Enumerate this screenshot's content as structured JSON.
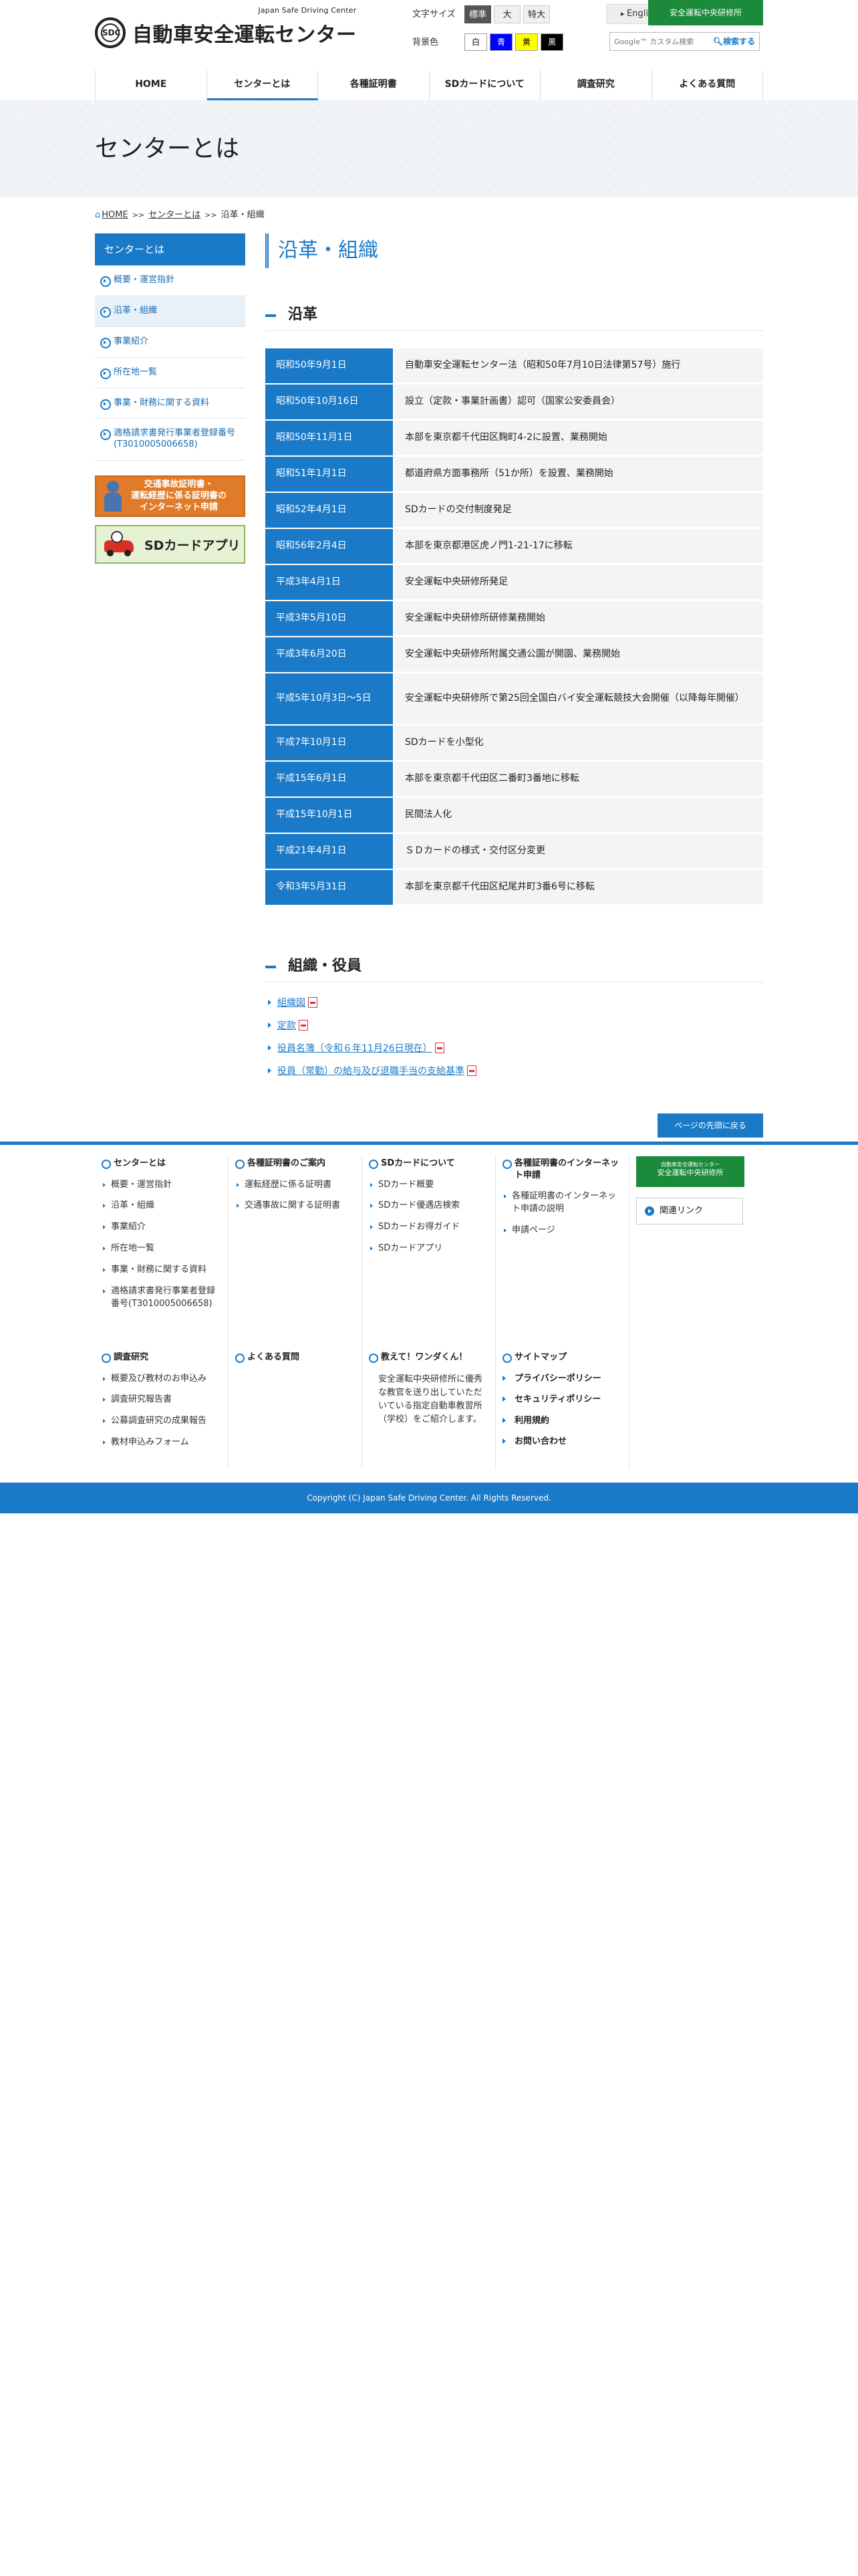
{
  "header": {
    "logo_sub": "Japan Safe Driving Center",
    "logo_main": "自動車安全運転センター",
    "logo_mark": "SDC",
    "font_size_label": "文字サイズ",
    "font_sizes": [
      "標準",
      "大",
      "特大"
    ],
    "english": "English",
    "training_center": "安全運転中央研修所",
    "bg_label": "背景色",
    "bg_colors": [
      {
        "label": "白",
        "bg": "#ffffff",
        "fg": "#000000"
      },
      {
        "label": "青",
        "bg": "#0000ff",
        "fg": "#ffffff"
      },
      {
        "label": "黄",
        "bg": "#ffff00",
        "fg": "#000000"
      },
      {
        "label": "黒",
        "bg": "#000000",
        "fg": "#ffffff"
      }
    ],
    "search_placeholder": "Google™ カスタム検索",
    "search_button": "検索する"
  },
  "gnav": [
    "HOME",
    "センターとは",
    "各種証明書",
    "SDカードについて",
    "調査研究",
    "よくある質問"
  ],
  "page_title": "センターとは",
  "breadcrumb": {
    "home": "HOME",
    "parent": "センターとは",
    "current": "沿革・組織"
  },
  "sidebar": {
    "heading": "センターとは",
    "items": [
      "概要・運営指針",
      "沿革・組織",
      "事業紹介",
      "所在地一覧",
      "事業・財務に関する資料",
      "適格請求書発行事業者登録番号(T3010005006658)"
    ],
    "banner1": "交通事故証明書・\n運転経歴に係る証明書の\nインターネット申請",
    "banner2": "SDカードアプリ"
  },
  "main": {
    "title": "沿革・組織",
    "history_heading": "沿革",
    "history": [
      {
        "date": "昭和50年9月1日",
        "text": "自動車安全運転センター法（昭和50年7月10日法律第57号）施行"
      },
      {
        "date": "昭和50年10月16日",
        "text": "設立（定款・事業計画書）認可（国家公安委員会）"
      },
      {
        "date": "昭和50年11月1日",
        "text": "本部を東京都千代田区麹町4-2に設置、業務開始"
      },
      {
        "date": "昭和51年1月1日",
        "text": "都道府県方面事務所（51か所）を設置、業務開始"
      },
      {
        "date": "昭和52年4月1日",
        "text": "SDカードの交付制度発足"
      },
      {
        "date": "昭和56年2月4日",
        "text": "本部を東京都港区虎ノ門1-21-17に移転"
      },
      {
        "date": "平成3年4月1日",
        "text": "安全運転中央研修所発足"
      },
      {
        "date": "平成3年5月10日",
        "text": "安全運転中央研修所研修業務開始"
      },
      {
        "date": "平成3年6月20日",
        "text": "安全運転中央研修所附属交通公園が開園、業務開始"
      },
      {
        "date": "平成5年10月3日～5日",
        "text": "安全運転中央研修所で第25回全国白バイ安全運転競技大会開催（以降毎年開催）"
      },
      {
        "date": "平成7年10月1日",
        "text": "SDカードを小型化"
      },
      {
        "date": "平成15年6月1日",
        "text": "本部を東京都千代田区二番町3番地に移転"
      },
      {
        "date": "平成15年10月1日",
        "text": "民間法人化"
      },
      {
        "date": "平成21年4月1日",
        "text": "ＳＤカードの様式・交付区分変更"
      },
      {
        "date": "令和3年5月31日",
        "text": "本部を東京都千代田区紀尾井町3番6号に移転"
      }
    ],
    "org_heading": "組織・役員",
    "org_links": [
      "組織図",
      "定款",
      "役員名簿（令和６年11月26日現在）",
      "役員（常勤）の給与及び退職手当の支給基準"
    ]
  },
  "pagetop": "ページの先頭に戻る",
  "footer": {
    "cols1": [
      {
        "heading": "センターとは",
        "items": [
          "概要・運営指針",
          "沿革・組織",
          "事業紹介",
          "所在地一覧",
          "事業・財務に関する資料",
          "適格請求書発行事業者登録番号(T3010005006658)"
        ]
      },
      {
        "heading": "各種証明書のご案内",
        "items": [
          "運転経歴に係る証明書",
          "交通事故に関する証明書"
        ]
      },
      {
        "heading": "SDカードについて",
        "items": [
          "SDカード概要",
          "SDカード優遇店検索",
          "SDカードお得ガイド",
          "SDカードアプリ"
        ]
      },
      {
        "heading": "各種証明書のインターネット申請",
        "items": [
          "各種証明書のインターネット申請の説明",
          "申請ページ"
        ]
      }
    ],
    "banner_sub": "自動車安全運転センター",
    "banner_main": "安全運転中央研修所",
    "related": "関連リンク",
    "research": {
      "heading": "調査研究",
      "items": [
        "概要及び教材のお申込み",
        "調査研究報告書",
        "公募調査研究の成果報告",
        "教材申込みフォーム"
      ]
    },
    "faq": "よくある質問",
    "wanda": {
      "heading": "教えて！ワンダくん！",
      "text": "安全運転中央研修所に優秀な教官を送り出していただいている指定自動車教習所（学校）をご紹介します。"
    },
    "misc": [
      "サイトマップ",
      "プライバシーポリシー",
      "セキュリティポリシー",
      "利用規約",
      "お問い合わせ"
    ],
    "copyright": "Copyright (C) Japan Safe Driving Center. All Rights Reserved."
  }
}
